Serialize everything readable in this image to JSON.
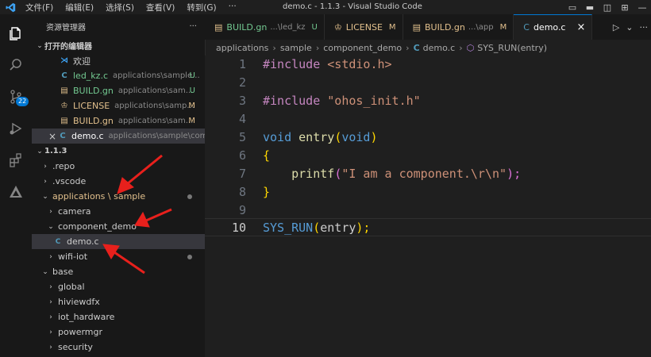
{
  "menu": [
    "文件(F)",
    "编辑(E)",
    "选择(S)",
    "查看(V)",
    "转到(G)",
    "···"
  ],
  "window_title": "demo.c - 1.1.3 - Visual Studio Code",
  "source_control_badge": "22",
  "explorer": {
    "title": "资源管理器",
    "more": "···",
    "open_editors_title": "打开的编辑器",
    "open_editors": [
      {
        "icon": "vscode-icon",
        "name": "欢迎",
        "path": "",
        "status": ""
      },
      {
        "icon": "c-file-icon",
        "name": "led_kz.c",
        "path": "applications\\sample...",
        "status": "U"
      },
      {
        "icon": "gn-file-icon",
        "name": "BUILD.gn",
        "path": "applications\\sam...",
        "status": "U"
      },
      {
        "icon": "license-icon",
        "name": "LICENSE",
        "path": "applications\\samp...",
        "status": "M"
      },
      {
        "icon": "gn-file-icon",
        "name": "BUILD.gn",
        "path": "applications\\sam...",
        "status": "M"
      },
      {
        "icon": "c-file-icon",
        "name": "demo.c",
        "path": "applications\\sample\\com...",
        "status": ""
      }
    ],
    "root_title": "1.1.3",
    "tree": [
      {
        "indent": 1,
        "twisty": "›",
        "name": ".repo"
      },
      {
        "indent": 1,
        "twisty": "›",
        "name": ".vscode"
      },
      {
        "indent": 1,
        "twisty": "⌄",
        "name": "applications \\ sample"
      },
      {
        "indent": 2,
        "twisty": "›",
        "name": "camera"
      },
      {
        "indent": 2,
        "twisty": "⌄",
        "name": "component_demo"
      },
      {
        "indent": 3,
        "twisty": "",
        "name": "demo.c"
      },
      {
        "indent": 2,
        "twisty": "›",
        "name": "wifi-iot"
      },
      {
        "indent": 1,
        "twisty": "⌄",
        "name": "base"
      },
      {
        "indent": 2,
        "twisty": "›",
        "name": "global"
      },
      {
        "indent": 2,
        "twisty": "›",
        "name": "hiviewdfx"
      },
      {
        "indent": 2,
        "twisty": "›",
        "name": "iot_hardware"
      },
      {
        "indent": 2,
        "twisty": "›",
        "name": "powermgr"
      },
      {
        "indent": 2,
        "twisty": "›",
        "name": "security"
      }
    ]
  },
  "tabs": [
    {
      "name": "BUILD.gn",
      "path": "...\\led_kz",
      "status": "U"
    },
    {
      "name": "LICENSE",
      "path": "",
      "status": "M"
    },
    {
      "name": "BUILD.gn",
      "path": "...\\app",
      "status": "M"
    },
    {
      "name": "demo.c",
      "path": "",
      "status": "×"
    }
  ],
  "tab_actions": [
    "▷",
    "⌄",
    "···"
  ],
  "breadcrumb": [
    "applications",
    "sample",
    "component_demo",
    "demo.c",
    "SYS_RUN(entry)"
  ],
  "code": {
    "line_numbers": [
      "1",
      "2",
      "3",
      "4",
      "5",
      "6",
      "7",
      "8",
      "9",
      "10"
    ],
    "l1_kw": "#include",
    "l1_str": "<stdio.h>",
    "l3_kw": "#include",
    "l3_str": "\"ohos_init.h\"",
    "l5_type": "void",
    "l5_fn": "entry",
    "l5_open": "(",
    "l5_arg": "void",
    "l5_close": ")",
    "l6": "{",
    "l7_fn": "printf",
    "l7_open": "(",
    "l7_str": "\"I am a component.\\r\\n\"",
    "l7_close": ");",
    "l8": "}",
    "l10_macro": "SYS_RUN",
    "l10_open": "(",
    "l10_arg": "entry",
    "l10_close": ");"
  },
  "colors": {
    "accent": "#0078d4",
    "annotation_arrow": "#e8201c"
  }
}
